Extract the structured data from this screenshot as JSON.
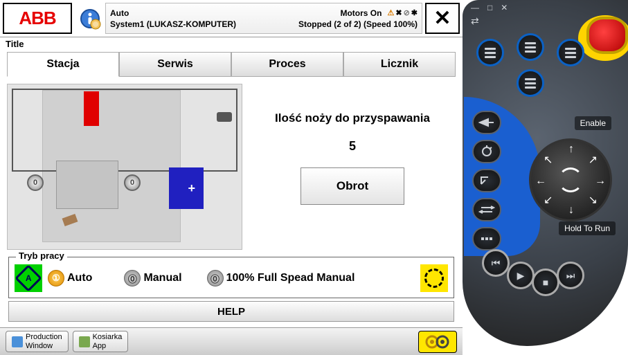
{
  "logo": "ABB",
  "status": {
    "mode": "Auto",
    "motors": "Motors On",
    "system": "System1 (LUKASZ-KOMPUTER)",
    "stopped": "Stopped (2 of 2) (Speed 100%)"
  },
  "title": "Title",
  "tabs": {
    "t0": "Stacja",
    "t1": "Serwis",
    "t2": "Proces",
    "t3": "Licznik"
  },
  "knife_label": "Ilość noży do przyspawania",
  "knife_value": "5",
  "obrot": "Obrot",
  "mode_group": "Tryb pracy",
  "modes": {
    "auto": "Auto",
    "manual": "Manual",
    "full": "100% Full Spead Manual"
  },
  "help": "HELP",
  "taskbar": {
    "prod1": "Production",
    "prod2": "Window",
    "kos1": "Kosiarka",
    "kos2": "App"
  },
  "pendant": {
    "enable": "Enable",
    "hold": "Hold To Run"
  }
}
